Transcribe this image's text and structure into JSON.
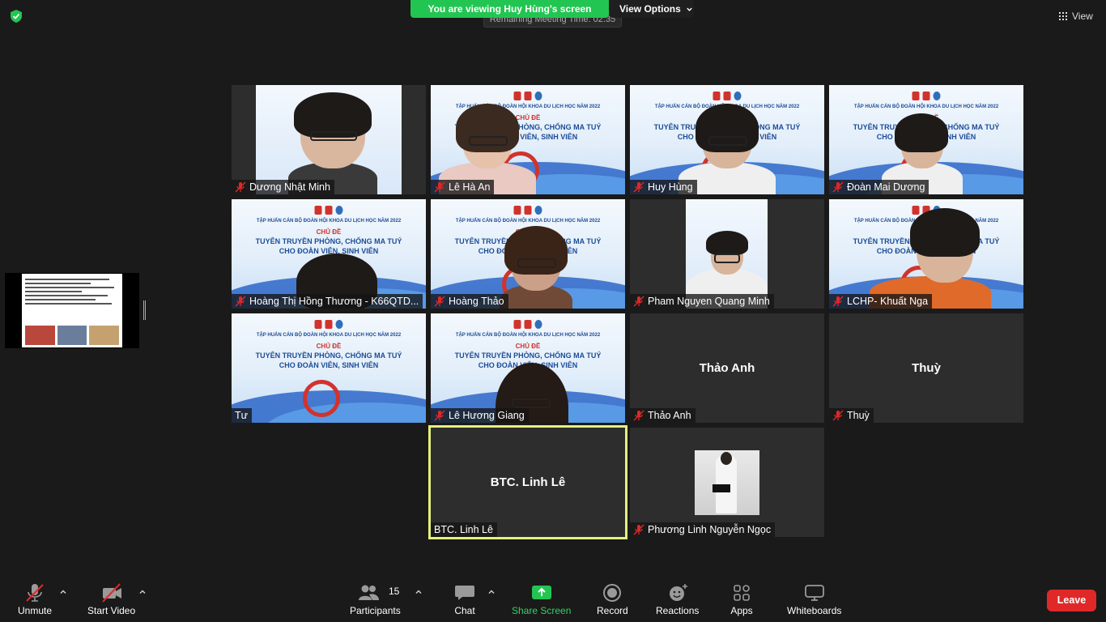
{
  "banner": {
    "viewing": "You are viewing Huy Hùng's screen",
    "view_options": "View Options",
    "remaining": "Remaining Meeting Time: 02:35",
    "view_label": "View"
  },
  "slide": {
    "subtitle": "TẬP HUẤN CÁN BỘ ĐOÀN HỘI KHOA DU LỊCH HỌC NĂM 2022",
    "chu_de": "CHỦ ĐỀ",
    "line1": "TUYÊN TRUYỀN PHÒNG, CHỐNG MA TUÝ",
    "line2": "CHO ĐOÀN VIÊN, SINH VIÊN"
  },
  "participants": [
    {
      "name": "Dương Nhật Minh",
      "muted": true
    },
    {
      "name": "Lê Hà An",
      "muted": true
    },
    {
      "name": "Huy Hùng",
      "muted": true
    },
    {
      "name": "Đoàn Mai Dương",
      "muted": true
    },
    {
      "name": "Hoàng Thị Hồng Thương - K66QTD...",
      "muted": true
    },
    {
      "name": "Hoàng Thảo",
      "muted": true
    },
    {
      "name": "Pham Nguyen Quang Minh",
      "muted": true
    },
    {
      "name": "LCHP- Khuất Nga",
      "muted": true
    },
    {
      "name": "Tư",
      "muted": false
    },
    {
      "name": "Lê Hương Giang",
      "muted": true
    },
    {
      "name": "Thảo Anh",
      "muted": true,
      "center_name": "Thảo Anh"
    },
    {
      "name": "Thuỳ",
      "muted": true,
      "center_name": "Thuỳ"
    },
    {
      "name": "BTC. Linh Lê",
      "muted": false,
      "center_name": "BTC. Linh Lê",
      "active_speaker": true
    },
    {
      "name": "Phương Linh Nguyễn Ngọc",
      "muted": true
    }
  ],
  "toolbar": {
    "unmute": "Unmute",
    "start_video": "Start Video",
    "participants": "Participants",
    "participant_count": "15",
    "chat": "Chat",
    "share_screen": "Share Screen",
    "record": "Record",
    "reactions": "Reactions",
    "apps": "Apps",
    "whiteboards": "Whiteboards",
    "leave": "Leave"
  },
  "colors": {
    "banner_green": "#23c552",
    "share_green": "#35d167",
    "leave_red": "#e02828",
    "active_speaker_border": "#e5f07d",
    "mute_red": "#e02828"
  },
  "icons": [
    "shield-icon",
    "grid-icon",
    "chevron-down-icon",
    "mic-muted-icon",
    "video-off-icon",
    "participants-icon",
    "chat-icon",
    "share-screen-icon",
    "record-icon",
    "reactions-icon",
    "apps-icon",
    "whiteboard-icon"
  ]
}
